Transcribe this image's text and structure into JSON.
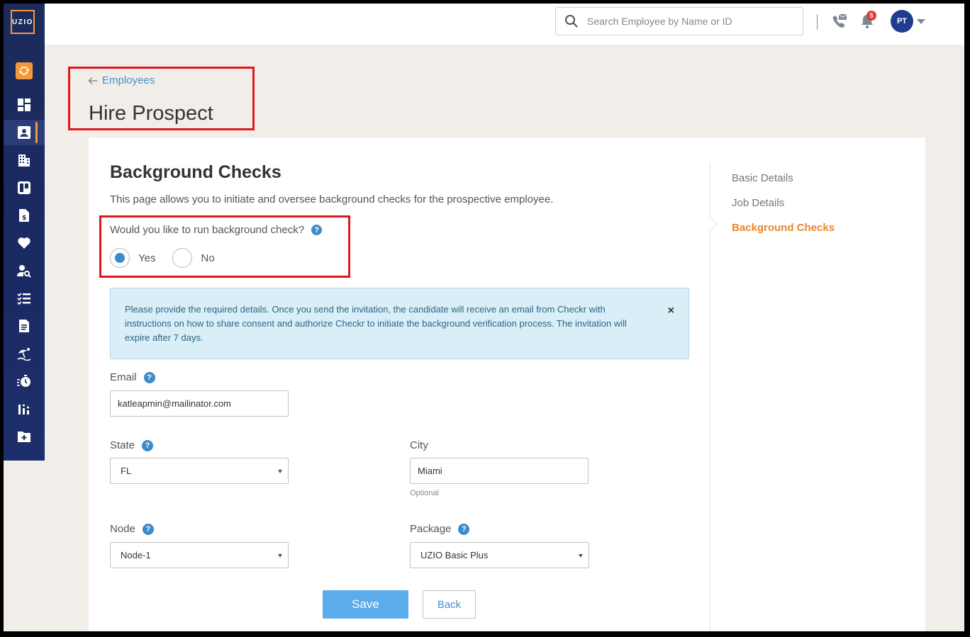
{
  "logo": {
    "text": "UZIO"
  },
  "header": {
    "search_placeholder": "Search Employee by Name or ID",
    "notification_count": "5",
    "avatar_initials": "PT"
  },
  "breadcrumb": {
    "back_label": "Employees"
  },
  "page_title": "Hire Prospect",
  "section": {
    "title": "Background Checks",
    "description": "This page allows you to initiate and oversee background checks for the prospective employee."
  },
  "question": {
    "label": "Would you like to run background check?",
    "options": [
      "Yes",
      "No"
    ],
    "selected": "Yes"
  },
  "info_message": "Please provide the required details. Once you send the invitation, the candidate will receive an email from Checkr with instructions on how to share consent and authorize Checkr to initiate the background verification process. The invitation will expire after 7 days.",
  "form": {
    "email": {
      "label": "Email",
      "value": "katleapmin@mailinator.com"
    },
    "state": {
      "label": "State",
      "value": "FL"
    },
    "city": {
      "label": "City",
      "value": "Miami",
      "hint": "Optional"
    },
    "node": {
      "label": "Node",
      "value": "Node-1"
    },
    "package": {
      "label": "Package",
      "value": "UZIO Basic Plus"
    }
  },
  "buttons": {
    "save": "Save",
    "back": "Back"
  },
  "steps": [
    {
      "label": "Basic Details",
      "active": false
    },
    {
      "label": "Job Details",
      "active": false
    },
    {
      "label": "Background Checks",
      "active": true
    }
  ],
  "colors": {
    "accent": "#e8872a",
    "primary": "#3d8bc9",
    "sidebar": "#1c2b5c"
  }
}
